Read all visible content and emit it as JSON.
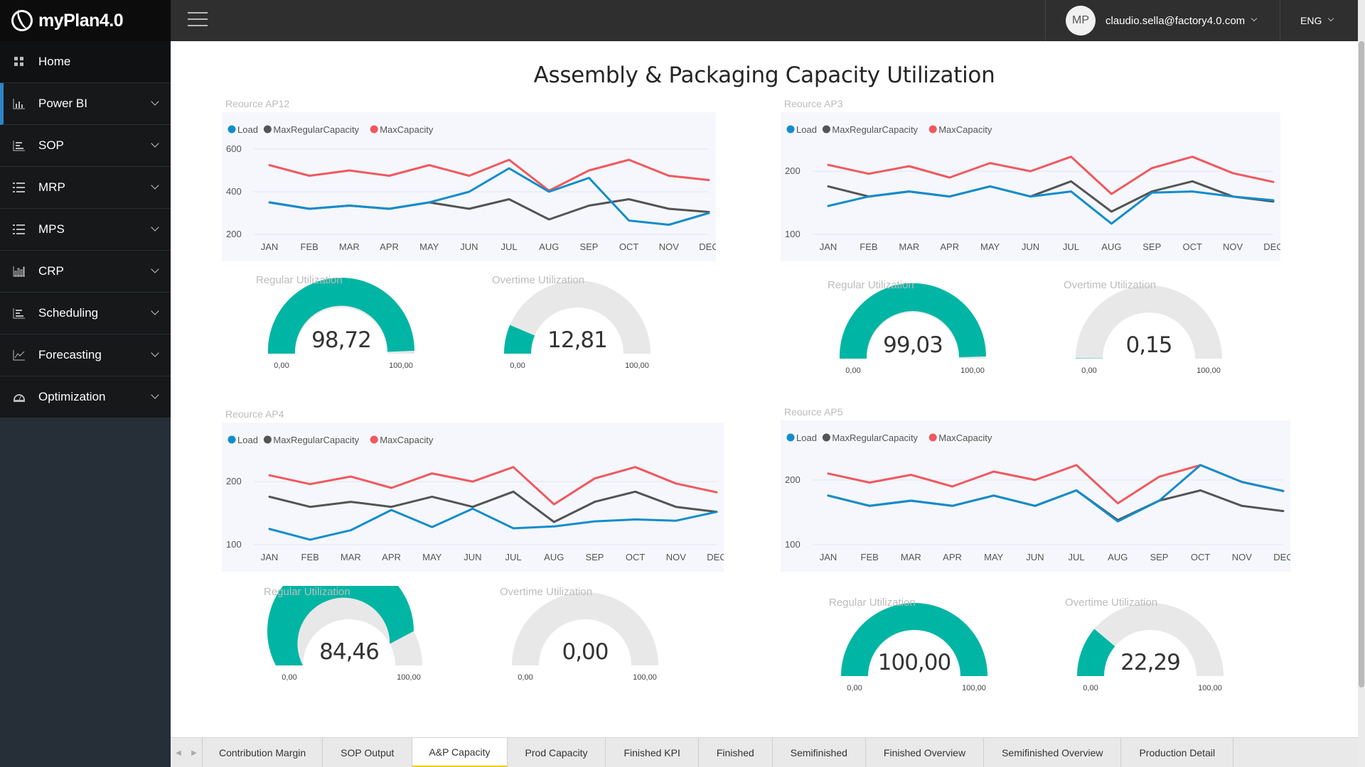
{
  "app": {
    "name": "myPlan4.0"
  },
  "sidebar": {
    "items": [
      {
        "label": "Home",
        "icon": "grid-icon"
      },
      {
        "label": "Power BI",
        "icon": "bar-chart-icon"
      },
      {
        "label": "SOP",
        "icon": "list-chart-icon"
      },
      {
        "label": "MRP",
        "icon": "checklist-icon"
      },
      {
        "label": "MPS",
        "icon": "checklist-icon"
      },
      {
        "label": "CRP",
        "icon": "column-chart-icon"
      },
      {
        "label": "Scheduling",
        "icon": "list-chart-icon"
      },
      {
        "label": "Forecasting",
        "icon": "line-chart-icon"
      },
      {
        "label": "Optimization",
        "icon": "gauge-icon"
      }
    ]
  },
  "topbar": {
    "avatar_initials": "MP",
    "user_email": "claudio.sella@factory4.0.com",
    "language": "ENG"
  },
  "report": {
    "title": "Assembly & Packaging Capacity Utilization"
  },
  "colors": {
    "load": "#118dcc",
    "max_regular": "#545454",
    "max": "#f0585e",
    "gauge_fill": "#00b5a4",
    "gauge_bg": "#e8e8e8"
  },
  "legend": {
    "load": "Load",
    "max_regular": "MaxRegularCapacity",
    "max": "MaxCapacity"
  },
  "chart_data": [
    {
      "type": "line",
      "title": "Reource AP12",
      "categories": [
        "JAN",
        "FEB",
        "MAR",
        "APR",
        "MAY",
        "JUN",
        "JUL",
        "AUG",
        "SEP",
        "OCT",
        "NOV",
        "DEC"
      ],
      "yticks": [
        200,
        400,
        600
      ],
      "ylim": [
        200,
        600
      ],
      "series": [
        {
          "name": "Load",
          "values": [
            350,
            320,
            335,
            320,
            350,
            400,
            510,
            400,
            465,
            265,
            245,
            300
          ]
        },
        {
          "name": "MaxRegularCapacity",
          "values": [
            350,
            320,
            335,
            320,
            350,
            320,
            365,
            270,
            335,
            365,
            320,
            305
          ]
        },
        {
          "name": "MaxCapacity",
          "values": [
            525,
            475,
            500,
            475,
            525,
            475,
            550,
            405,
            500,
            550,
            475,
            455
          ]
        }
      ]
    },
    {
      "type": "line",
      "title": "Reource AP3",
      "categories": [
        "JAN",
        "FEB",
        "MAR",
        "APR",
        "MAY",
        "JUN",
        "JUL",
        "AUG",
        "SEP",
        "OCT",
        "NOV",
        "DEC"
      ],
      "yticks": [
        100,
        200
      ],
      "ylim": [
        100,
        235
      ],
      "series": [
        {
          "name": "Load",
          "values": [
            145,
            160,
            168,
            160,
            176,
            160,
            168,
            117,
            166,
            168,
            160,
            154
          ]
        },
        {
          "name": "MaxRegularCapacity",
          "values": [
            176,
            160,
            168,
            160,
            176,
            160,
            184,
            136,
            168,
            184,
            160,
            152
          ]
        },
        {
          "name": "MaxCapacity",
          "values": [
            210,
            196,
            208,
            190,
            213,
            200,
            223,
            164,
            205,
            223,
            197,
            183
          ]
        }
      ]
    },
    {
      "type": "line",
      "title": "Reource AP4",
      "categories": [
        "JAN",
        "FEB",
        "MAR",
        "APR",
        "MAY",
        "JUN",
        "JUL",
        "AUG",
        "SEP",
        "OCT",
        "NOV",
        "DEC"
      ],
      "yticks": [
        100,
        200
      ],
      "ylim": [
        100,
        235
      ],
      "series": [
        {
          "name": "Load",
          "values": [
            125,
            108,
            123,
            155,
            128,
            157,
            126,
            129,
            137,
            140,
            138,
            152
          ]
        },
        {
          "name": "MaxRegularCapacity",
          "values": [
            176,
            160,
            168,
            160,
            176,
            160,
            184,
            136,
            168,
            184,
            160,
            152
          ]
        },
        {
          "name": "MaxCapacity",
          "values": [
            210,
            196,
            208,
            190,
            213,
            200,
            223,
            164,
            205,
            223,
            197,
            183
          ]
        }
      ]
    },
    {
      "type": "line",
      "title": "Reource AP5",
      "categories": [
        "JAN",
        "FEB",
        "MAR",
        "APR",
        "MAY",
        "JUN",
        "JUL",
        "AUG",
        "SEP",
        "OCT",
        "NOV",
        "DEC"
      ],
      "yticks": [
        100,
        200
      ],
      "ylim": [
        100,
        235
      ],
      "series": [
        {
          "name": "Load",
          "values": [
            176,
            160,
            168,
            160,
            176,
            160,
            184,
            136,
            168,
            223,
            197,
            183
          ]
        },
        {
          "name": "MaxRegularCapacity",
          "values": [
            176,
            160,
            168,
            160,
            176,
            160,
            184,
            138,
            168,
            184,
            160,
            152
          ]
        },
        {
          "name": "MaxCapacity",
          "values": [
            210,
            196,
            208,
            190,
            213,
            200,
            223,
            164,
            205,
            223,
            197,
            183
          ]
        }
      ]
    }
  ],
  "gauges": [
    {
      "title": "Regular Utilization",
      "value": 98.72,
      "display": "98,72",
      "min": "0,00",
      "max": "100,00"
    },
    {
      "title": "Overtime Utilization",
      "value": 12.81,
      "display": "12,81",
      "min": "0,00",
      "max": "100,00"
    },
    {
      "title": "Regular Utilization",
      "value": 99.03,
      "display": "99,03",
      "min": "0,00",
      "max": "100,00"
    },
    {
      "title": "Overtime Utilization",
      "value": 0.15,
      "display": "0,15",
      "min": "0,00",
      "max": "100,00"
    },
    {
      "title": "Regular Utilization",
      "value": 84.46,
      "display": "84,46",
      "min": "0,00",
      "max": "100,00"
    },
    {
      "title": "Overtime Utilization",
      "value": 0.0,
      "display": "0,00",
      "min": "0,00",
      "max": "100,00"
    },
    {
      "title": "Regular Utilization",
      "value": 100.0,
      "display": "100,00",
      "min": "0,00",
      "max": "100,00"
    },
    {
      "title": "Overtime Utilization",
      "value": 22.29,
      "display": "22,29",
      "min": "0,00",
      "max": "100,00"
    }
  ],
  "tabs": [
    {
      "label": "Contribution Margin"
    },
    {
      "label": "SOP Output"
    },
    {
      "label": "A&P Capacity",
      "active": true
    },
    {
      "label": "Prod Capacity"
    },
    {
      "label": "Finished KPI"
    },
    {
      "label": "Finished"
    },
    {
      "label": "Semifinished"
    },
    {
      "label": "Finished Overview"
    },
    {
      "label": "Semifinished Overview"
    },
    {
      "label": "Production Detail"
    }
  ]
}
